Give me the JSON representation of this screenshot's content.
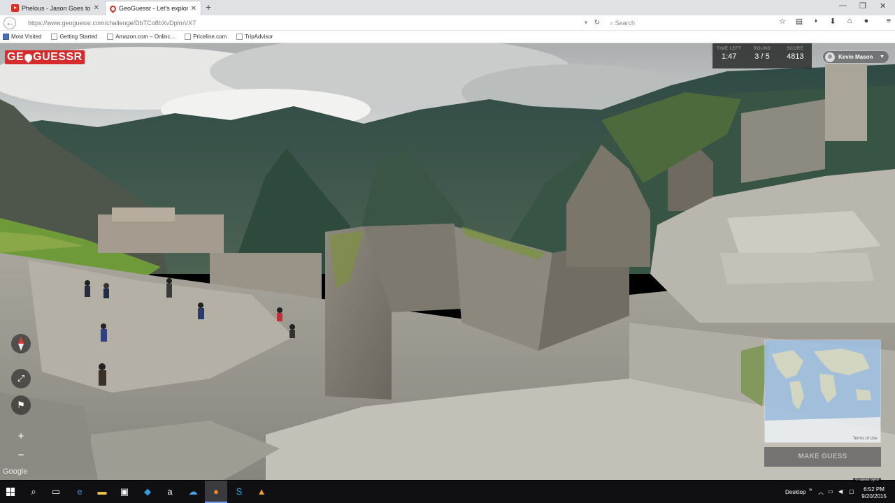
{
  "browser": {
    "tabs": [
      {
        "title": "Phelous - Jason Goes to H...",
        "favicon": "youtube-icon",
        "active": false
      },
      {
        "title": "GeoGuessr - Let's explore t...",
        "favicon": "geoguessr-pin-icon",
        "active": true
      }
    ],
    "url": "https://www.geoguessr.com/challenge/DbTCo8bXvDplmVX7",
    "search_placeholder": "Search",
    "bookmarks": [
      "Most Visited",
      "Getting Started",
      "Amazon.com – Onlinc...",
      "Priceline.com",
      "TripAdvisor"
    ]
  },
  "game": {
    "logo_left": "GE",
    "logo_right": "GUESSR",
    "hud": {
      "time_label": "TIME LEFT",
      "time_value": "1:47",
      "round_label": "ROUND",
      "round_value": "3 / 5",
      "score_label": "SCORE",
      "score_value": "4813"
    },
    "user": "Kevin Mason",
    "google_watermark": "Google",
    "map_terms": "Terms of Use",
    "make_guess": "MAKE GUESS"
  },
  "taskbar": {
    "desktop_label": "Desktop",
    "time": "6:52 PM",
    "date": "9/20/2015",
    "display_badge": "© david byrd"
  }
}
